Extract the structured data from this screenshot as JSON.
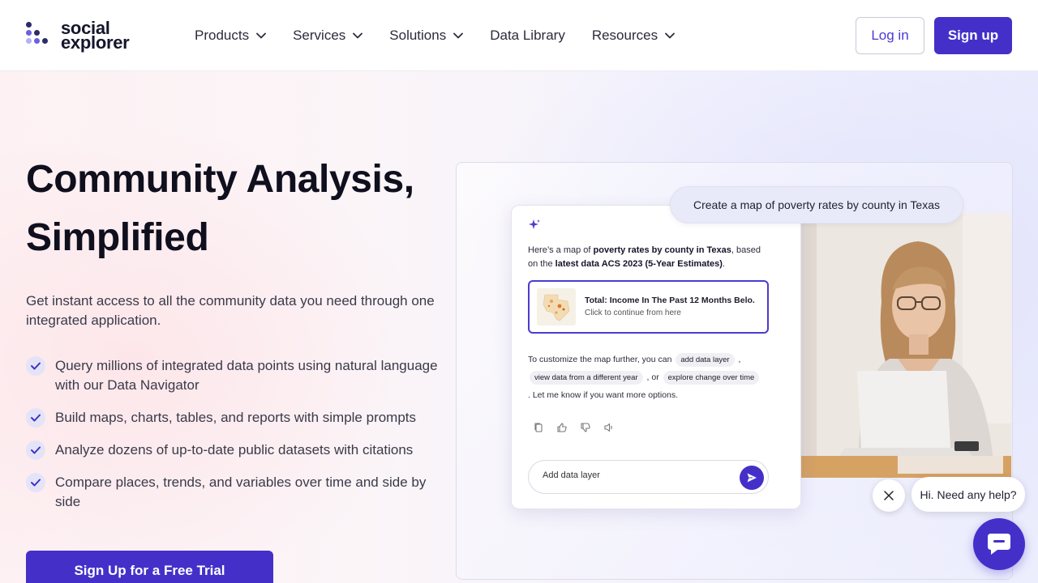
{
  "brand": {
    "name_line1": "social",
    "name_line2": "explorer",
    "colors": {
      "primary": "#4430c9",
      "dot_dark": "#2b2b6b",
      "dot_mid": "#6d5ee0",
      "dot_light": "#b7b0f0"
    }
  },
  "nav": {
    "items": [
      {
        "label": "Products",
        "has_dropdown": true
      },
      {
        "label": "Services",
        "has_dropdown": true
      },
      {
        "label": "Solutions",
        "has_dropdown": true
      },
      {
        "label": "Data Library",
        "has_dropdown": false
      },
      {
        "label": "Resources",
        "has_dropdown": true
      }
    ],
    "login_label": "Log in",
    "signup_label": "Sign up"
  },
  "hero": {
    "title_line1": "Community Analysis,",
    "title_line2": "Simplified",
    "lead": "Get instant access to all the community data you need through one integrated application.",
    "bullets": [
      "Query millions of integrated data points using natural language with our Data Navigator",
      "Build maps, charts, tables, and reports with simple prompts",
      "Analyze dozens of up-to-date public datasets with citations",
      "Compare places, trends, and variables over time and side by side"
    ],
    "cta_label": "Sign Up for a Free Trial"
  },
  "demo": {
    "user_prompt": "Create a map of poverty rates by county in Texas",
    "response": {
      "part1": "Here’s a map of ",
      "bold1": "poverty rates by county in Texas",
      "part2": ", based on the ",
      "bold2": "latest data ACS 2023 (5-Year Estimates)",
      "part3": "."
    },
    "map_card": {
      "title": "Total: Income In The Past 12 Months Belo...",
      "subtitle": "Click to continue from here"
    },
    "customize": {
      "text_before": "To customize the map further, you can",
      "chip1": "add data layer",
      "sep1": ",",
      "chip2": "view data from a different year",
      "sep2": ", or",
      "chip3": "explore change over time",
      "text_after": ". Let me know if you want more options."
    },
    "action_icons": [
      "copy-icon",
      "thumbs-up-icon",
      "thumbs-down-icon",
      "speaker-icon"
    ],
    "input_value": "Add data layer"
  },
  "chat_widget": {
    "message": "Hi. Need any help?"
  }
}
